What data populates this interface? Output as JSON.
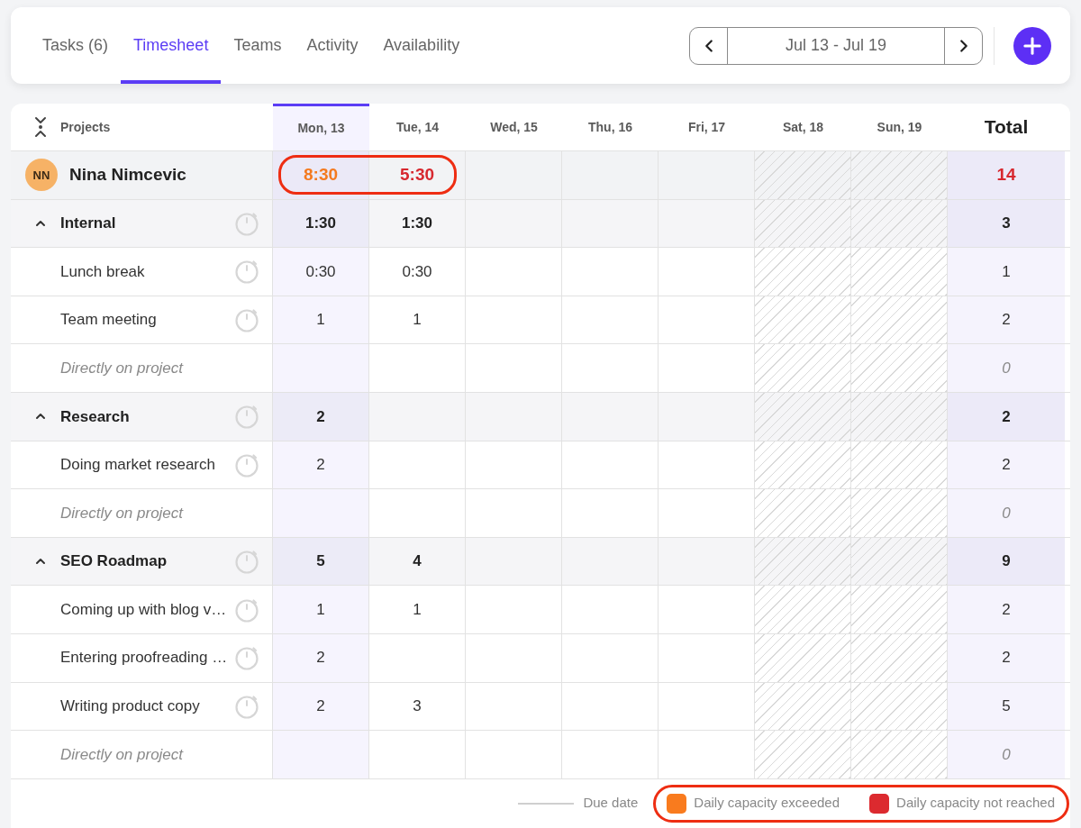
{
  "tabs": [
    {
      "label": "Tasks (6)",
      "selected": false
    },
    {
      "label": "Timesheet",
      "selected": true
    },
    {
      "label": "Teams",
      "selected": false
    },
    {
      "label": "Activity",
      "selected": false
    },
    {
      "label": "Availability",
      "selected": false
    }
  ],
  "date_nav": {
    "range": "Jul 13 - Jul 19"
  },
  "timesheet": {
    "projects_label": "Projects",
    "days": [
      {
        "label": "Mon, 13",
        "selected": true,
        "weekend": false
      },
      {
        "label": "Tue, 14",
        "selected": false,
        "weekend": false
      },
      {
        "label": "Wed, 15",
        "selected": false,
        "weekend": false
      },
      {
        "label": "Thu, 16",
        "selected": false,
        "weekend": false
      },
      {
        "label": "Fri, 17",
        "selected": false,
        "weekend": false
      },
      {
        "label": "Sat, 18",
        "selected": false,
        "weekend": true
      },
      {
        "label": "Sun, 19",
        "selected": false,
        "weekend": true
      }
    ],
    "total_label": "Total",
    "person": {
      "initials": "NN",
      "name": "Nina Nimcevic",
      "hours": {
        "day_1": {
          "value": "8:30",
          "color": "#f47a1f"
        },
        "day_2": {
          "value": "5:30",
          "color": "#d7282f"
        }
      },
      "total": {
        "value": "14",
        "color": "#d7282f"
      },
      "outlined": true
    },
    "projects": [
      {
        "name": "Internal",
        "expanded": true,
        "hours": {
          "day_1": "1:30",
          "day_2": "1:30"
        },
        "total": "3",
        "rows": [
          {
            "kind": "task",
            "name": "Lunch break",
            "hours": {
              "day_1": "0:30",
              "day_2": "0:30"
            },
            "total": "1"
          },
          {
            "kind": "task",
            "name": "Team meeting",
            "hours": {
              "day_1": "1",
              "day_2": "1"
            },
            "total": "2"
          },
          {
            "kind": "direct",
            "name": "Directly on project",
            "total": "0"
          }
        ]
      },
      {
        "name": "Research",
        "expanded": true,
        "hours": {
          "day_1": "2"
        },
        "total": "2",
        "rows": [
          {
            "kind": "task",
            "name": "Doing market research",
            "hours": {
              "day_1": "2"
            },
            "total": "2"
          },
          {
            "kind": "direct",
            "name": "Directly on project",
            "total": "0"
          }
        ]
      },
      {
        "name": "SEO Roadmap",
        "expanded": true,
        "hours": {
          "day_1": "5",
          "day_2": "4"
        },
        "total": "9",
        "rows": [
          {
            "kind": "task",
            "name": "Coming up with blog v…",
            "hours": {
              "day_1": "1",
              "day_2": "1"
            },
            "total": "2"
          },
          {
            "kind": "task",
            "name": "Entering proofreading …",
            "hours": {
              "day_1": "2"
            },
            "total": "2"
          },
          {
            "kind": "task",
            "name": "Writing product copy",
            "hours": {
              "day_1": "2",
              "day_2": "3"
            },
            "total": "5"
          },
          {
            "kind": "direct",
            "name": "Directly on project",
            "total": "0"
          }
        ]
      }
    ]
  },
  "legend": {
    "due_date": {
      "label": "Due date"
    },
    "capacity": {
      "outlined": true,
      "items": [
        {
          "label": "Daily capacity exceeded",
          "color": "#f97b1e"
        },
        {
          "label": "Daily capacity not reached",
          "color": "#dc2a2f"
        }
      ]
    }
  }
}
